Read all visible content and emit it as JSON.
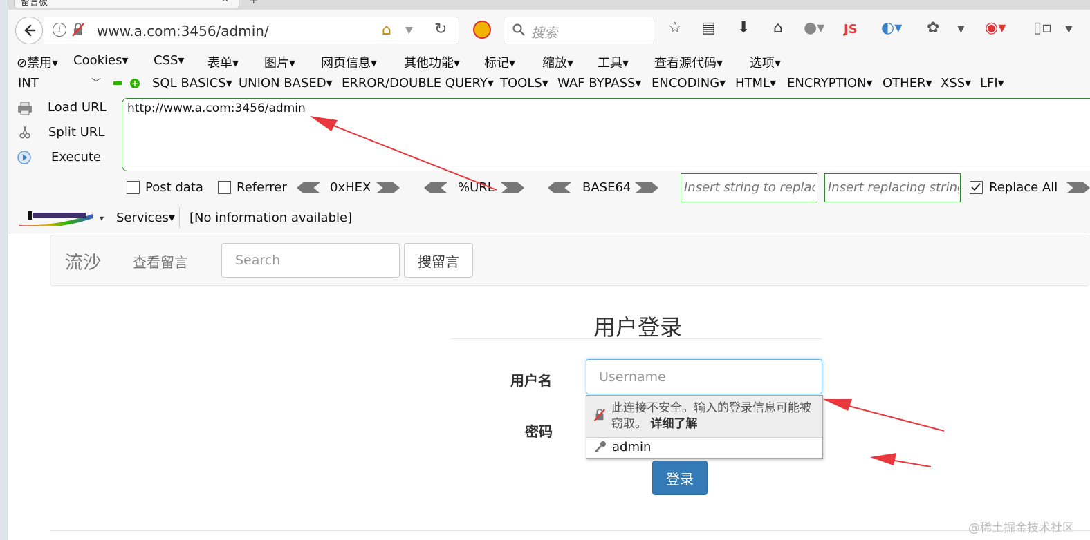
{
  "browser": {
    "tab_title": "留言板",
    "url": "www.a.com:3456/admin/",
    "search_placeholder": "搜索"
  },
  "cn_toolbar": [
    "⊘禁用▾",
    "Cookies▾",
    "CSS▾",
    "表单▾",
    "图片▾",
    "网页信息▾",
    "其他功能▾",
    "标记▾",
    "缩放▾",
    "工具▾",
    "查看源代码▾",
    "选项▾"
  ],
  "hackbar": {
    "type_select": "INT",
    "menus": [
      "SQL BASICS▾",
      "UNION BASED▾",
      "ERROR/DOUBLE QUERY▾",
      "TOOLS▾",
      "WAF BYPASS▾",
      "ENCODING▾",
      "HTML▾",
      "ENCRYPTION▾",
      "OTHER▾",
      "XSS▾",
      "LFI▾"
    ],
    "load_url": "Load URL",
    "split_url": "Split URL",
    "execute": "Execute",
    "url_value": "http://www.a.com:3456/admin",
    "post_data": "Post data",
    "referrer": "Referrer",
    "hex": "0xHEX",
    "url_enc": "%URL",
    "base64": "BASE64",
    "insert_replace_ph": "Insert string to replace",
    "insert_replacing_ph": "Insert replacing string",
    "replace_all": "Replace All",
    "replace_all_checked": true
  },
  "netcraft": {
    "services": "Services▾",
    "info": "[No information available]"
  },
  "page": {
    "brand": "流沙",
    "nav_link": "查看留言",
    "search_placeholder": "Search",
    "search_button": "搜留言",
    "login_title": "用户登录",
    "username_label": "用户名",
    "username_placeholder": "Username",
    "password_label": "密码",
    "login_button": "登录",
    "popup_warning": "此连接不安全。输入的登录信息可能被窃取。",
    "popup_learn_more": "详细了解",
    "popup_saved_user": "admin"
  },
  "watermark": "@稀土掘金技术社区",
  "colors": {
    "accent_blue": "#337ab7",
    "annotation_red": "#e8383d",
    "hackbar_green": "#2a8a2a"
  }
}
